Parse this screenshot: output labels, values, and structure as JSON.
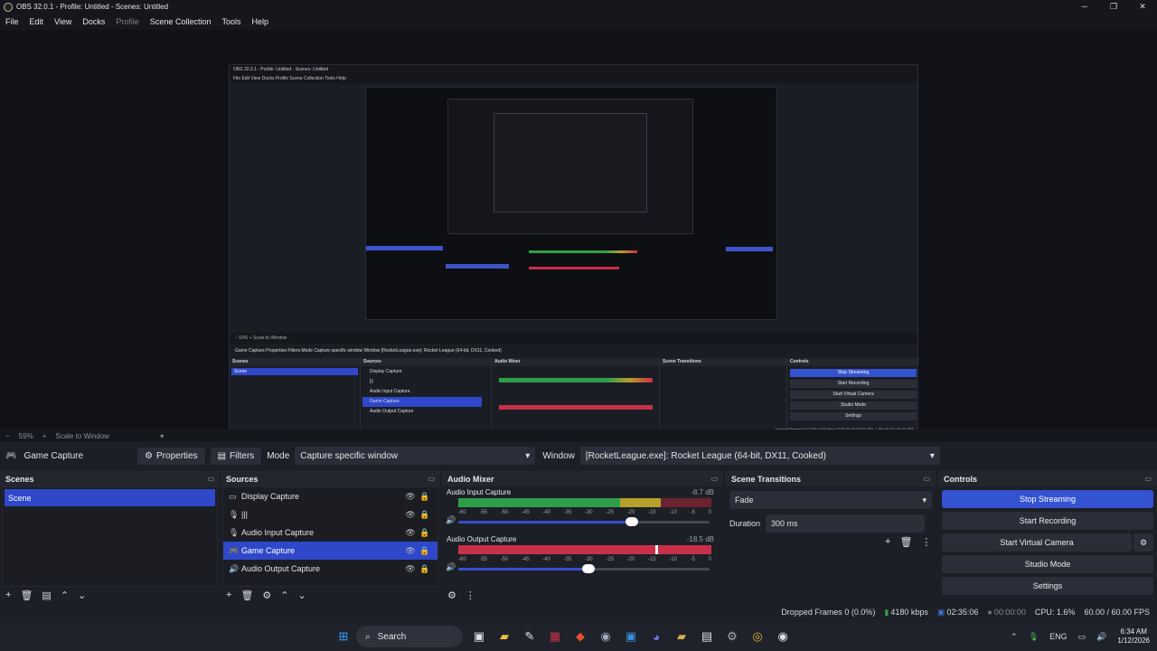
{
  "window": {
    "title": "OBS 32.0.1 - Profile: Untitled - Scenes: Untitled"
  },
  "menu": [
    "File",
    "Edit",
    "View",
    "Docks",
    "Profile",
    "Scene Collection",
    "Tools",
    "Help"
  ],
  "preview": {
    "title": "OBS 32.0.1 - Profile: Untitled - Scenes: Untitled",
    "menu": "File  Edit  View  Docks  Profile  Scene Collection  Tools  Help",
    "toolbar": "−  59%  +  Scale to Window",
    "srcbar": "Game Capture    Properties    Filters    Mode  Capture specific window    Window  [RocketLeague.exe]: Rocket League (64-bit, DX11, Cooked)",
    "status": "Dropped Frames 0 (0.0%)   4180 kbps   02:35:06   00:00:00   CPU: 1.6%   60.00 / 60.00 FPS",
    "scenes_head": "Scenes",
    "sources_head": "Sources",
    "mixer_head": "Audio Mixer",
    "transitions_head": "Scene Transitions",
    "controls_head": "Controls",
    "scene_item": "Scene",
    "sources": [
      "Display Capture",
      "|||",
      "Audio Input Capture",
      "Game Capture",
      "Audio Output Capture"
    ],
    "controls": [
      "Stop Streaming",
      "Start Recording",
      "Start Virtual Camera",
      "Studio Mode",
      "Settings"
    ]
  },
  "zoom": {
    "minus": "−",
    "percent": "59%",
    "plus": "+",
    "scale_label": "Scale to Window"
  },
  "source_bar": {
    "source_name": "Game Capture",
    "properties_label": "Properties",
    "filters_label": "Filters",
    "mode_label": "Mode",
    "mode_value": "Capture specific window",
    "window_label": "Window",
    "window_value": "[RocketLeague.exe]: Rocket League (64-bit, DX11, Cooked)"
  },
  "scenes": {
    "title": "Scenes",
    "items": [
      "Scene"
    ]
  },
  "sources": {
    "title": "Sources",
    "items": [
      {
        "icon": "monitor-icon",
        "glyph": "▭",
        "name": "Display Capture"
      },
      {
        "icon": "microphone-icon",
        "glyph": "🎙",
        "name": "|||"
      },
      {
        "icon": "microphone-icon",
        "glyph": "🎙",
        "name": "Audio Input Capture"
      },
      {
        "icon": "gamepad-icon",
        "glyph": "🎮",
        "name": "Game Capture"
      },
      {
        "icon": "speaker-icon",
        "glyph": "🔊",
        "name": "Audio Output Capture"
      }
    ]
  },
  "mixer": {
    "title": "Audio Mixer",
    "channels": [
      {
        "name": "Audio Input Capture",
        "db": "-8.7 dB",
        "volume": 0.68
      },
      {
        "name": "Audio Output Capture",
        "db": "-18.5 dB",
        "volume": 0.48
      }
    ],
    "ticks": [
      "-60",
      "-55",
      "-50",
      "-45",
      "-40",
      "-35",
      "-30",
      "-25",
      "-20",
      "-15",
      "-10",
      "-5",
      "0"
    ]
  },
  "transitions": {
    "title": "Scene Transitions",
    "selected": "Fade",
    "duration_label": "Duration",
    "duration_value": "300 ms"
  },
  "controls": {
    "title": "Controls",
    "stop_streaming": "Stop Streaming",
    "start_recording": "Start Recording",
    "start_virtual_camera": "Start Virtual Camera",
    "studio_mode": "Studio Mode",
    "settings": "Settings"
  },
  "status": {
    "dropped_frames": "Dropped Frames 0 (0.0%)",
    "bitrate": "4180 kbps",
    "stream_time": "02:35:06",
    "record_time": "00:00:00",
    "cpu": "CPU: 1.6%",
    "fps": "60.00 / 60.00 FPS"
  },
  "taskbar": {
    "search_label": "Search",
    "time": "6:34 AM",
    "date": "1/12/2026",
    "tray_lang": "ENG"
  },
  "colors": {
    "accent": "#2f48c9",
    "meter_green": "#2e9e4b",
    "meter_yellow": "#b5a02a",
    "meter_red": "#c8304a"
  }
}
